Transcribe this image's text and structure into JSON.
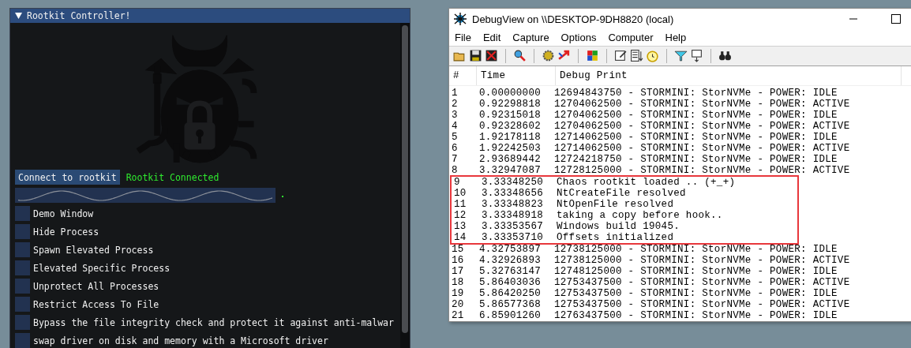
{
  "controller": {
    "title": "Rootkit Controller!",
    "connect_button": "Connect to rootkit",
    "status": "Rootkit Connected",
    "options": [
      {
        "label": "Demo Window",
        "checked": false
      },
      {
        "label": "Hide Process",
        "checked": false
      },
      {
        "label": "Spawn Elevated Process",
        "checked": false
      },
      {
        "label": "Elevated Specific Process",
        "checked": false
      },
      {
        "label": "Unprotect All Processes",
        "checked": false
      },
      {
        "label": "Restrict Access To File",
        "checked": false
      },
      {
        "label": "Bypass the file integrity check and protect it against anti-malwar",
        "checked": false
      },
      {
        "label": "swap driver on disk and memory with a Microsoft driver",
        "checked": false
      }
    ]
  },
  "debugview": {
    "title": "DebugView on \\\\DESKTOP-9DH8820 (local)",
    "menu": [
      "File",
      "Edit",
      "Capture",
      "Options",
      "Computer",
      "Help"
    ],
    "columns": [
      "#",
      "Time",
      "Debug Print"
    ],
    "rows": [
      {
        "index": "1",
        "time": "0.00000000",
        "message": "12694843750 - STORMINI: StorNVMe - POWER: IDLE",
        "highlighted": false
      },
      {
        "index": "2",
        "time": "0.92298818",
        "message": "12704062500 - STORMINI: StorNVMe - POWER: ACTIVE",
        "highlighted": false
      },
      {
        "index": "3",
        "time": "0.92315018",
        "message": "12704062500 - STORMINI: StorNVMe - POWER: IDLE",
        "highlighted": false
      },
      {
        "index": "4",
        "time": "0.92328602",
        "message": "12704062500 - STORMINI: StorNVMe - POWER: ACTIVE",
        "highlighted": false
      },
      {
        "index": "5",
        "time": "1.92178118",
        "message": "12714062500 - STORMINI: StorNVMe - POWER: IDLE",
        "highlighted": false
      },
      {
        "index": "6",
        "time": "1.92242503",
        "message": "12714062500 - STORMINI: StorNVMe - POWER: ACTIVE",
        "highlighted": false
      },
      {
        "index": "7",
        "time": "2.93689442",
        "message": "12724218750 - STORMINI: StorNVMe - POWER: IDLE",
        "highlighted": false
      },
      {
        "index": "8",
        "time": "3.32947087",
        "message": "12728125000 - STORMINI: StorNVMe - POWER: ACTIVE",
        "highlighted": false
      },
      {
        "index": "9",
        "time": "3.33348250",
        "message": "Chaos rootkit loaded .. (+_+)",
        "highlighted": true
      },
      {
        "index": "10",
        "time": "3.33348656",
        "message": "NtCreateFile resolved",
        "highlighted": true
      },
      {
        "index": "11",
        "time": "3.33348823",
        "message": "NtOpenFile resolved",
        "highlighted": true
      },
      {
        "index": "12",
        "time": "3.33348918",
        "message": "taking a copy before hook..",
        "highlighted": true
      },
      {
        "index": "13",
        "time": "3.33353567",
        "message": "Windows build 19045.",
        "highlighted": true
      },
      {
        "index": "14",
        "time": "3.33353710",
        "message": "Offsets initialized",
        "highlighted": true
      },
      {
        "index": "15",
        "time": "4.32753897",
        "message": "12738125000 - STORMINI: StorNVMe - POWER: IDLE",
        "highlighted": false
      },
      {
        "index": "16",
        "time": "4.32926893",
        "message": "12738125000 - STORMINI: StorNVMe - POWER: ACTIVE",
        "highlighted": false
      },
      {
        "index": "17",
        "time": "5.32763147",
        "message": "12748125000 - STORMINI: StorNVMe - POWER: IDLE",
        "highlighted": false
      },
      {
        "index": "18",
        "time": "5.86403036",
        "message": "12753437500 - STORMINI: StorNVMe - POWER: ACTIVE",
        "highlighted": false
      },
      {
        "index": "19",
        "time": "5.86420250",
        "message": "12753437500 - STORMINI: StorNVMe - POWER: IDLE",
        "highlighted": false
      },
      {
        "index": "20",
        "time": "5.86577368",
        "message": "12753437500 - STORMINI: StorNVMe - POWER: ACTIVE",
        "highlighted": false
      },
      {
        "index": "21",
        "time": "6.85901260",
        "message": "12763437500 - STORMINI: StorNVMe - POWER: IDLE",
        "highlighted": false
      }
    ]
  }
}
